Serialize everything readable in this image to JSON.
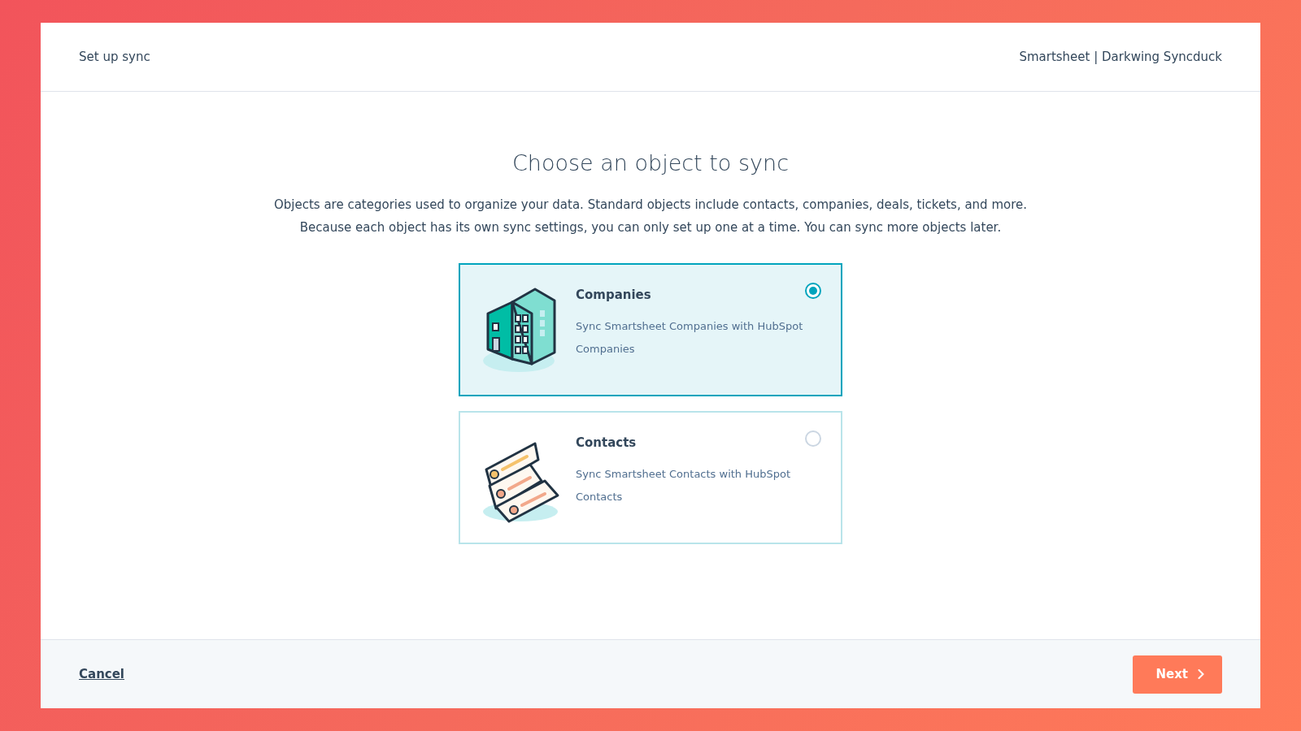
{
  "header": {
    "title": "Set up sync",
    "account": "Smartsheet | Darkwing Syncduck"
  },
  "main": {
    "heading": "Choose an object to sync",
    "description_lines": [
      "Objects are categories used to organize your data. Standard objects include contacts, companies, deals, tickets, and more.",
      "Because each object has its own sync settings, you can only set up one at a time. You can sync more objects later."
    ]
  },
  "options": [
    {
      "kind": "companies",
      "title": "Companies",
      "description": "Sync Smartsheet Companies with HubSpot Companies",
      "selected": true
    },
    {
      "kind": "contacts",
      "title": "Contacts",
      "description": "Sync Smartsheet Contacts with HubSpot Contacts",
      "selected": false
    }
  ],
  "footer": {
    "cancel": "Cancel",
    "next": "Next"
  }
}
